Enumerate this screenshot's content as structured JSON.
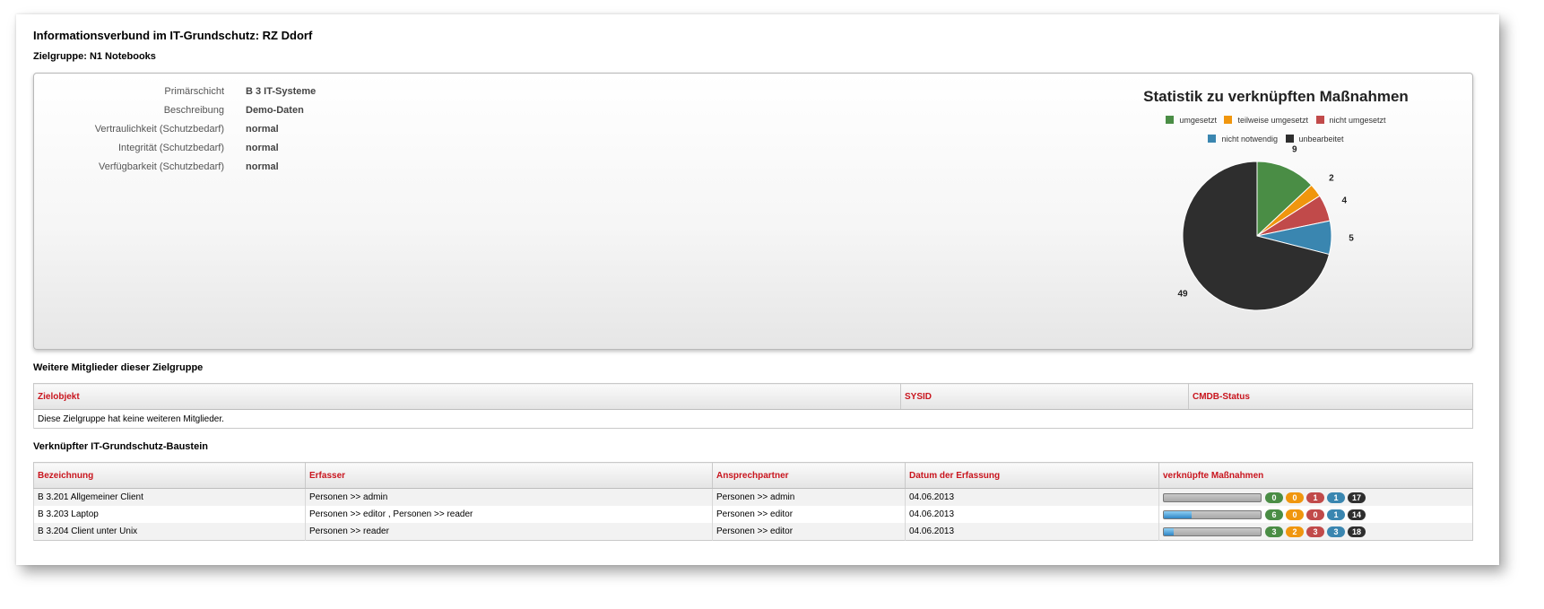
{
  "header": {
    "title": "Informationsverbund im IT-Grundschutz: RZ Ddorf",
    "subtitle": "Zielgruppe: N1 Notebooks"
  },
  "properties": [
    {
      "label": "Primärschicht",
      "value": "B 3 IT-Systeme"
    },
    {
      "label": "Beschreibung",
      "value": "Demo-Daten"
    },
    {
      "label": "Vertraulichkeit (Schutzbedarf)",
      "value": "normal"
    },
    {
      "label": "Integrität (Schutzbedarf)",
      "value": "normal"
    },
    {
      "label": "Verfügbarkeit (Schutzbedarf)",
      "value": "normal"
    }
  ],
  "chart_data": {
    "type": "pie",
    "title": "Statistik zu verknüpften Maßnahmen",
    "legend_position": "top",
    "slices": [
      {
        "name": "umgesetzt",
        "value": 9,
        "color": "#4a8d45"
      },
      {
        "name": "teilweise umgesetzt",
        "value": 2,
        "color": "#f0960e"
      },
      {
        "name": "nicht umgesetzt",
        "value": 4,
        "color": "#c14a4a"
      },
      {
        "name": "nicht notwendig",
        "value": 5,
        "color": "#3a86b0"
      },
      {
        "name": "unbearbeitet",
        "value": 49,
        "color": "#2e2e2e"
      }
    ]
  },
  "members": {
    "heading": "Weitere Mitglieder dieser Zielgruppe",
    "columns": [
      "Zielobjekt",
      "SYSID",
      "CMDB-Status"
    ],
    "empty_text": "Diese Zielgruppe hat keine weiteren Mitglieder."
  },
  "modules": {
    "heading": "Verknüpfter IT-Grundschutz-Baustein",
    "columns": [
      "Bezeichnung",
      "Erfasser",
      "Ansprechpartner",
      "Datum der Erfassung",
      "verknüpfte Maßnahmen"
    ],
    "rows": [
      {
        "name": "B 3.201 Allgemeiner Client",
        "erfasser": "Personen >> admin",
        "ansprechpartner": "Personen >> admin",
        "datum": "04.06.2013",
        "progress": 0.0,
        "counts": [
          "0",
          "0",
          "1",
          "1",
          "17"
        ]
      },
      {
        "name": "B 3.203 Laptop",
        "erfasser": "Personen >> editor , Personen >> reader",
        "ansprechpartner": "Personen >> editor",
        "datum": "04.06.2013",
        "progress": 0.29,
        "counts": [
          "6",
          "0",
          "0",
          "1",
          "14"
        ]
      },
      {
        "name": "B 3.204 Client unter Unix",
        "erfasser": "Personen >> reader",
        "ansprechpartner": "Personen >> editor",
        "datum": "04.06.2013",
        "progress": 0.1,
        "counts": [
          "3",
          "2",
          "3",
          "3",
          "18"
        ]
      }
    ],
    "badge_colors": [
      "#4a8d45",
      "#f0960e",
      "#c14a4a",
      "#3a86b0",
      "#2e2e2e"
    ]
  }
}
